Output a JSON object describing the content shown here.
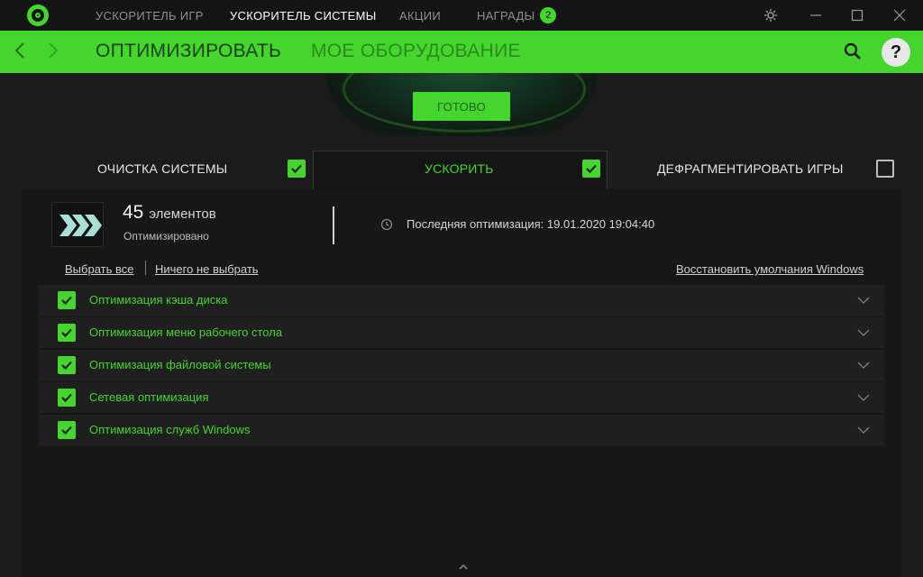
{
  "titlebar": {
    "tabs": [
      {
        "label": "УСКОРИТЕЛЬ ИГР"
      },
      {
        "label": "УСКОРИТЕЛЬ СИСТЕМЫ"
      },
      {
        "label": "АКЦИИ"
      },
      {
        "label": "НАГРАДЫ"
      }
    ],
    "rewards_badge": "2",
    "active_tab": "УСКОРИТЕЛЬ СИСТЕМЫ"
  },
  "subnav": {
    "tabs": [
      {
        "label": "ОПТИМИЗИРОВАТЬ"
      },
      {
        "label": "МОЕ ОБОРУДОВАНИЕ"
      }
    ],
    "active_tab": "ОПТИМИЗИРОВАТЬ",
    "help_label": "?"
  },
  "action": {
    "done_label": "ГОТОВО"
  },
  "categories": [
    {
      "label": "ОЧИСТКА СИСТЕМЫ",
      "checked": true
    },
    {
      "label": "УСКОРИТЬ",
      "checked": true
    },
    {
      "label": "ДЕФРАГМЕНТИРОВАТЬ ИГРЫ",
      "checked": false
    }
  ],
  "summary": {
    "count": "45",
    "count_unit": "элементов",
    "status": "Оптимизировано",
    "last_optimization": "Последняя оптимизация: 19.01.2020 19:04:40"
  },
  "links": {
    "select_all": "Выбрать все",
    "select_none": "Ничего не выбрать",
    "restore_defaults": "Восстановить умолчания Windows"
  },
  "items": [
    {
      "label": "Оптимизация кэша диска",
      "checked": true
    },
    {
      "label": "Оптимизация меню рабочего стола",
      "checked": true
    },
    {
      "label": "Оптимизация файловой системы",
      "checked": true
    },
    {
      "label": "Сетевая оптимизация",
      "checked": true
    },
    {
      "label": "Оптимизация служб Windows",
      "checked": true
    }
  ],
  "colors": {
    "accent": "#44d62c",
    "background": "#1b1b1b",
    "titlebar": "#141414"
  },
  "icons": {
    "logo": "razer-cortex-logo-icon",
    "settings": "gear-icon",
    "minimize": "minimize-icon",
    "maximize": "maximize-icon",
    "close": "close-icon",
    "back": "chevron-left-icon",
    "forward": "chevron-right-icon",
    "search": "search-icon",
    "help": "help-icon",
    "boost": "triple-chevron-icon",
    "history": "clock-history-icon",
    "expand": "chevron-down-icon",
    "collapse": "chevron-up-icon"
  }
}
